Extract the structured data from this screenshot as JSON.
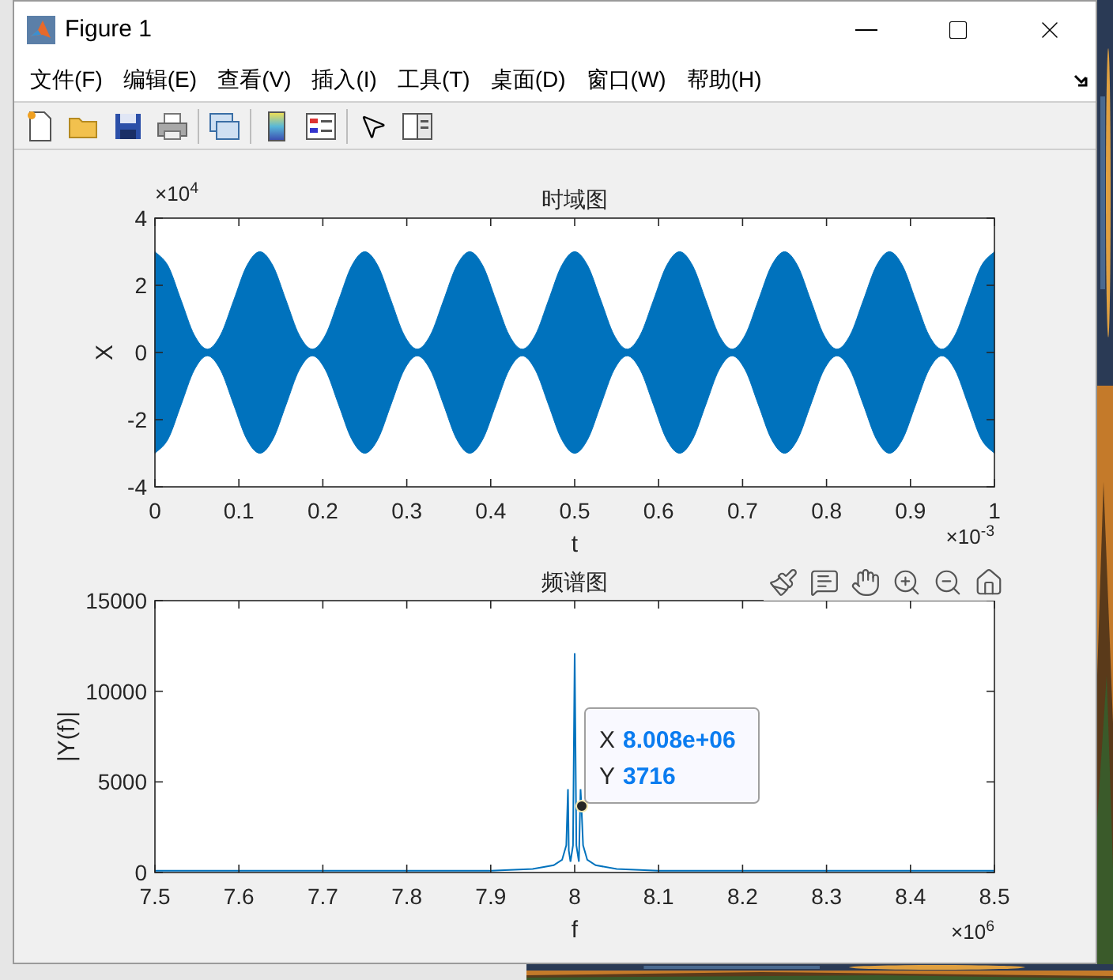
{
  "window": {
    "title": "Figure 1"
  },
  "menu": [
    {
      "label": "文件(F)"
    },
    {
      "label": "编辑(E)"
    },
    {
      "label": "查看(V)"
    },
    {
      "label": "插入(I)"
    },
    {
      "label": "工具(T)"
    },
    {
      "label": "桌面(D)"
    },
    {
      "label": "窗口(W)"
    },
    {
      "label": "帮助(H)"
    }
  ],
  "plots": [
    {
      "y_multiplier": "×10$^{4}$",
      "x_multiplier": "×10$^{-3}$",
      "chart_data": {
        "type": "area",
        "title": "时域图",
        "xlabel": "t",
        "ylabel": "X",
        "xlim": [
          0,
          1
        ],
        "ylim": [
          -4,
          4
        ],
        "xticks": [
          0,
          0.1,
          0.2,
          0.3,
          0.4,
          0.5,
          0.6,
          0.7,
          0.8,
          0.9,
          1
        ],
        "yticks": [
          -4,
          -2,
          0,
          2,
          4
        ],
        "x": [
          0,
          0.015625,
          0.03125,
          0.046875,
          0.0625,
          0.078125,
          0.09375,
          0.109375,
          0.125,
          0.140625,
          0.15625,
          0.171875,
          0.1875,
          0.203125,
          0.21875,
          0.234375,
          0.25,
          0.265625,
          0.28125,
          0.296875,
          0.3125,
          0.328125,
          0.34375,
          0.359375,
          0.375,
          0.390625,
          0.40625,
          0.421875,
          0.4375,
          0.453125,
          0.46875,
          0.484375,
          0.5,
          0.515625,
          0.53125,
          0.546875,
          0.5625,
          0.578125,
          0.59375,
          0.609375,
          0.625,
          0.640625,
          0.65625,
          0.671875,
          0.6875,
          0.703125,
          0.71875,
          0.734375,
          0.75,
          0.765625,
          0.78125,
          0.796875,
          0.8125,
          0.828125,
          0.84375,
          0.859375,
          0.875,
          0.890625,
          0.90625,
          0.921875,
          0.9375,
          0.953125,
          0.96875,
          0.984375,
          1
        ],
        "series": [
          {
            "color": "#0072bd",
            "values": [
              3.0,
              2.58,
              1.55,
              0.52,
              0.1,
              0.52,
              1.55,
              2.58,
              3.0,
              2.58,
              1.55,
              0.52,
              0.1,
              0.52,
              1.55,
              2.58,
              3.0,
              2.58,
              1.55,
              0.52,
              0.1,
              0.52,
              1.55,
              2.58,
              3.0,
              2.58,
              1.55,
              0.52,
              0.1,
              0.52,
              1.55,
              2.58,
              3.0,
              2.58,
              1.55,
              0.52,
              0.1,
              0.52,
              1.55,
              2.58,
              3.0,
              2.58,
              1.55,
              0.52,
              0.1,
              0.52,
              1.55,
              2.58,
              3.0,
              2.58,
              1.55,
              0.52,
              0.1,
              0.52,
              1.55,
              2.58,
              3.0,
              2.58,
              1.55,
              0.52,
              0.1,
              0.52,
              1.55,
              2.58,
              3.0
            ]
          },
          {
            "color": "#0072bd",
            "values": [
              -3.0,
              -2.58,
              -1.55,
              -0.52,
              -0.1,
              -0.52,
              -1.55,
              -2.58,
              -3.0,
              -2.58,
              -1.55,
              -0.52,
              -0.1,
              -0.52,
              -1.55,
              -2.58,
              -3.0,
              -2.58,
              -1.55,
              -0.52,
              -0.1,
              -0.52,
              -1.55,
              -2.58,
              -3.0,
              -2.58,
              -1.55,
              -0.52,
              -0.1,
              -0.52,
              -1.55,
              -2.58,
              -3.0,
              -2.58,
              -1.55,
              -0.52,
              -0.1,
              -0.52,
              -1.55,
              -2.58,
              -3.0,
              -2.58,
              -1.55,
              -0.52,
              -0.1,
              -0.52,
              -1.55,
              -2.58,
              -3.0,
              -2.58,
              -1.55,
              -0.52,
              -0.1,
              -0.52,
              -1.55,
              -2.58,
              -3.0,
              -2.58,
              -1.55,
              -0.52,
              -0.1,
              -0.52,
              -1.55,
              -2.58,
              -3.0
            ]
          }
        ]
      }
    },
    {
      "x_multiplier": "×10$^{6}$",
      "datatip": {
        "x_label": "X",
        "x_value": "8.008e+06",
        "y_label": "Y",
        "y_value": "3716"
      },
      "chart_data": {
        "type": "line",
        "title": "频谱图",
        "xlabel": "f",
        "ylabel": "|Y(f)|",
        "xlim": [
          7.5,
          8.5
        ],
        "ylim": [
          0,
          15000
        ],
        "xticks": [
          7.5,
          7.6,
          7.7,
          7.8,
          7.9,
          8,
          8.1,
          8.2,
          8.3,
          8.4,
          8.5
        ],
        "yticks": [
          0,
          5000,
          10000,
          15000
        ],
        "x": [
          7.5,
          7.9,
          7.95,
          7.975,
          7.985,
          7.99,
          7.992,
          7.993,
          7.995,
          7.998,
          8.0,
          8.002,
          8.005,
          8.007,
          8.008,
          8.01,
          8.015,
          8.025,
          8.05,
          8.1,
          8.5
        ],
        "series": [
          {
            "color": "#0072bd",
            "values": [
              100,
              100,
              200,
              400,
              700,
              1500,
              4600,
              1200,
              600,
              1500,
              12100,
              1500,
              600,
              4600,
              3700,
              1500,
              700,
              400,
              200,
              100,
              100
            ]
          }
        ]
      }
    }
  ]
}
